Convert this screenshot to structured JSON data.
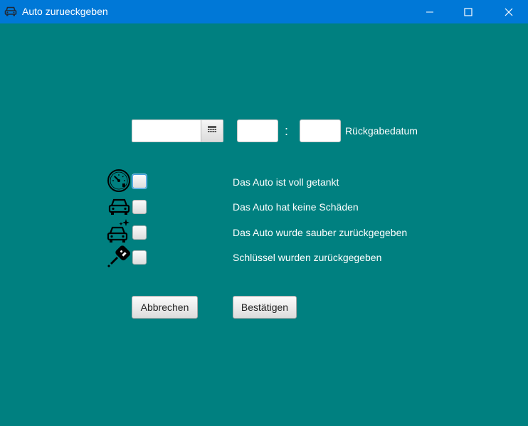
{
  "window": {
    "title": "Auto zurueckgeben",
    "icon": "car-icon",
    "controls": [
      "minimize-icon",
      "maximize-icon",
      "close-icon"
    ]
  },
  "form": {
    "date": {
      "value": "",
      "button_icon": "calendar-icon"
    },
    "hour": {
      "value": ""
    },
    "time_separator": ":",
    "minute": {
      "value": ""
    },
    "date_label": "Rückgabedatum"
  },
  "checklist": [
    {
      "icon": "fuel-gauge-icon",
      "checked": false,
      "label": "Das Auto ist voll getankt"
    },
    {
      "icon": "car-icon",
      "checked": false,
      "label": "Das Auto hat keine Schäden"
    },
    {
      "icon": "clean-car-icon",
      "checked": false,
      "label": "Das Auto wurde sauber zurückgegeben"
    },
    {
      "icon": "car-key-icon",
      "checked": false,
      "label": "Schlüssel wurden zurückgegeben"
    }
  ],
  "buttons": {
    "cancel": "Abbrechen",
    "confirm": "Bestätigen"
  },
  "colors": {
    "titlebar": "#0078d7",
    "background": "#008080"
  }
}
